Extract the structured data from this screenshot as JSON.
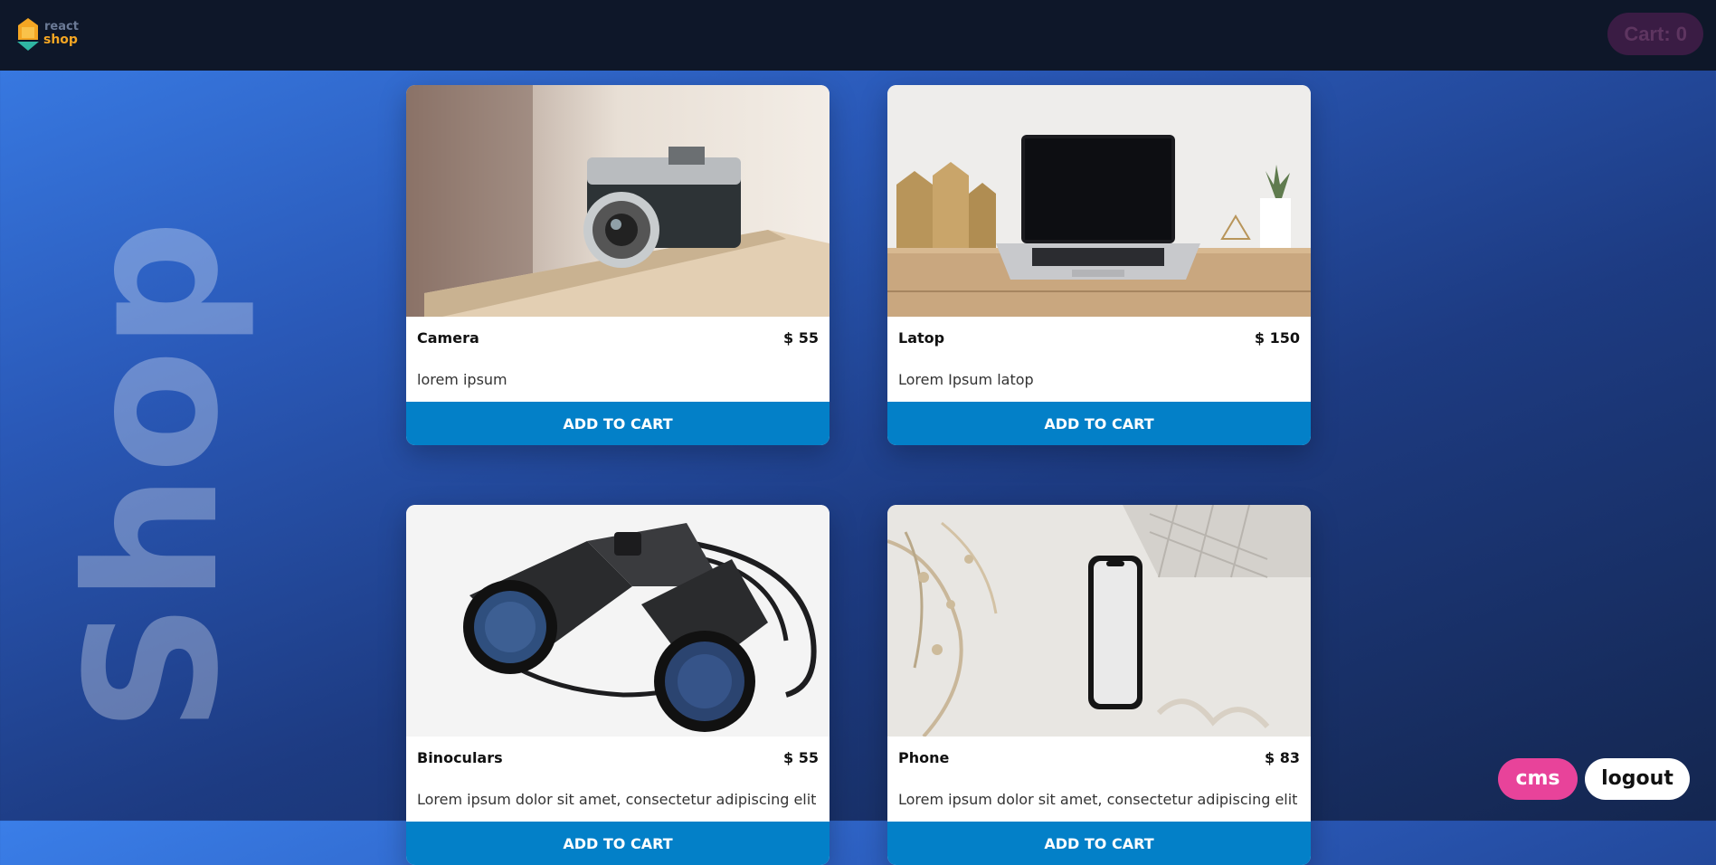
{
  "header": {
    "logo_top": "react",
    "logo_bottom": "shop",
    "cart_label": "Cart: 0"
  },
  "side_title": "Shop",
  "products": [
    {
      "name": "Camera",
      "price": "$ 55",
      "description": "lorem ipsum",
      "button": "ADD TO CART",
      "image": "camera-photo"
    },
    {
      "name": "Latop",
      "price": "$ 150",
      "description": "Lorem Ipsum latop",
      "button": "ADD TO CART",
      "image": "laptop-photo"
    },
    {
      "name": "Binoculars",
      "price": "$ 55",
      "description": "Lorem ipsum dolor sit amet, consectetur adipiscing elit",
      "button": "ADD TO CART",
      "image": "binoculars-photo"
    },
    {
      "name": "Phone",
      "price": "$ 83",
      "description": "Lorem ipsum dolor sit amet, consectetur adipiscing elit",
      "button": "ADD TO CART",
      "image": "phone-photo"
    }
  ],
  "footer": {
    "cms_label": "cms",
    "logout_label": "logout"
  },
  "colors": {
    "topbar": "#0e1729",
    "button_blue": "#0380c8",
    "cms_pink": "#e8439a",
    "logo_orange": "#f4a623"
  }
}
